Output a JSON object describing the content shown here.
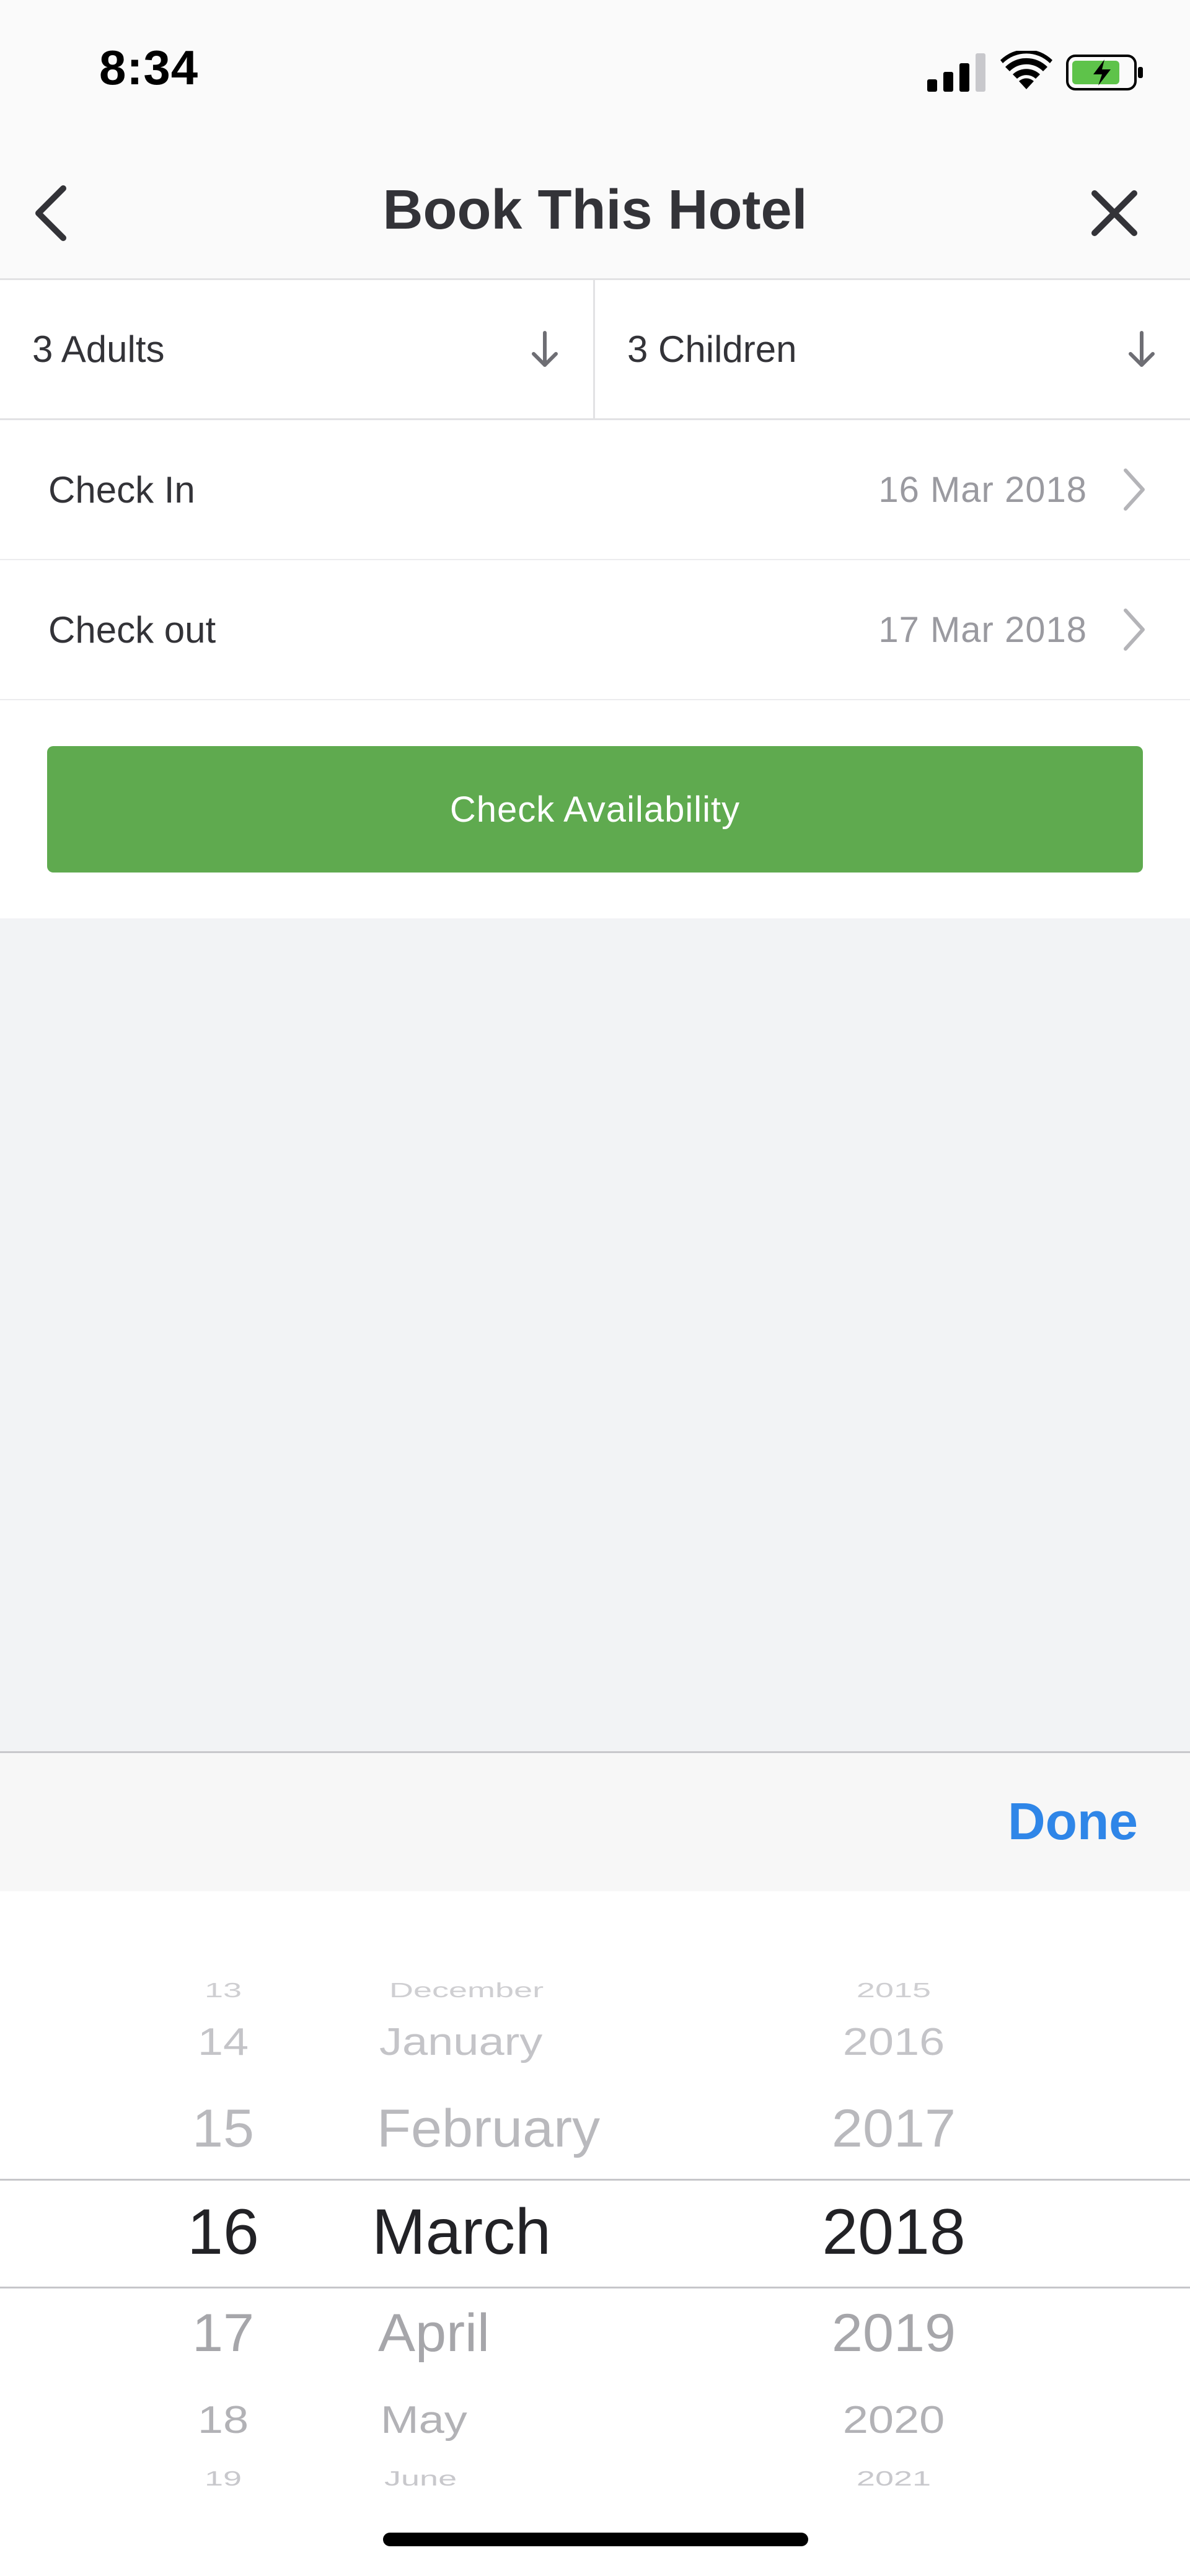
{
  "status_bar": {
    "time": "8:34",
    "icons": [
      "signal-icon",
      "wifi-icon",
      "battery-charging-icon"
    ],
    "battery_color": "#5ec34a"
  },
  "nav": {
    "title": "Book This Hotel",
    "back_icon": "chevron-left-icon",
    "close_icon": "close-icon"
  },
  "guests": {
    "adults_label": "3 Adults",
    "children_label": "3 Children",
    "dropdown_icon": "arrow-down-icon"
  },
  "dates": {
    "check_in_label": "Check In",
    "check_in_value": "16 Mar 2018",
    "check_out_label": "Check out",
    "check_out_value": "17 Mar 2018"
  },
  "actions": {
    "check_availability_label": "Check Availability",
    "button_color": "#5faa4f"
  },
  "picker": {
    "done_label": "Done",
    "done_color": "#2f86e8",
    "days": [
      "13",
      "14",
      "15",
      "16",
      "17",
      "18",
      "19"
    ],
    "months": [
      "December",
      "January",
      "February",
      "March",
      "April",
      "May",
      "June"
    ],
    "years": [
      "2015",
      "2016",
      "2017",
      "2018",
      "2019",
      "2020",
      "2021"
    ],
    "selected": {
      "day": "16",
      "month": "March",
      "year": "2018"
    }
  }
}
